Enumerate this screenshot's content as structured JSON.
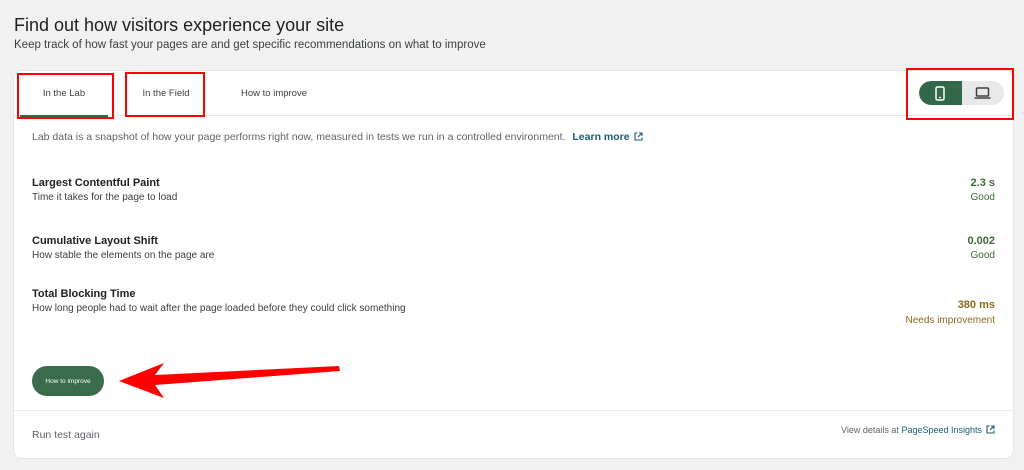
{
  "header": {
    "title": "Find out how visitors experience your site",
    "subtitle": "Keep track of how fast your pages are and get specific recommendations on what to improve"
  },
  "tabs": [
    {
      "label": "In the Lab",
      "active": true
    },
    {
      "label": "In the Field",
      "active": false
    },
    {
      "label": "How to improve",
      "active": false
    }
  ],
  "device_toggle": {
    "options": [
      "mobile-icon",
      "laptop-icon"
    ],
    "selected": "mobile"
  },
  "intro": {
    "text": "Lab data is a snapshot of how your page performs right now, measured in tests we run in a controlled environment.",
    "link_label": "Learn more"
  },
  "metrics": [
    {
      "name": "Largest Contentful Paint",
      "description": "Time it takes for the page to load",
      "value": "2.3 s",
      "status": "Good"
    },
    {
      "name": "Cumulative Layout Shift",
      "description": "How stable the elements on the page are",
      "value": "0.002",
      "status": "Good"
    },
    {
      "name": "Total Blocking Time",
      "description": "How long people had to wait after the page loaded before they could click something",
      "value": "380 ms",
      "status": "Needs improvement"
    }
  ],
  "improve_button_label": "How to improve",
  "footer": {
    "run_again_label": "Run test again",
    "view_details_prefix": "View details at",
    "view_details_link": "PageSpeed Insights"
  },
  "colors": {
    "accent": "#33694a",
    "link": "#1a5c72",
    "good": "#3d6b36",
    "warn": "#8b6a1c",
    "annotation": "#ff0000"
  }
}
